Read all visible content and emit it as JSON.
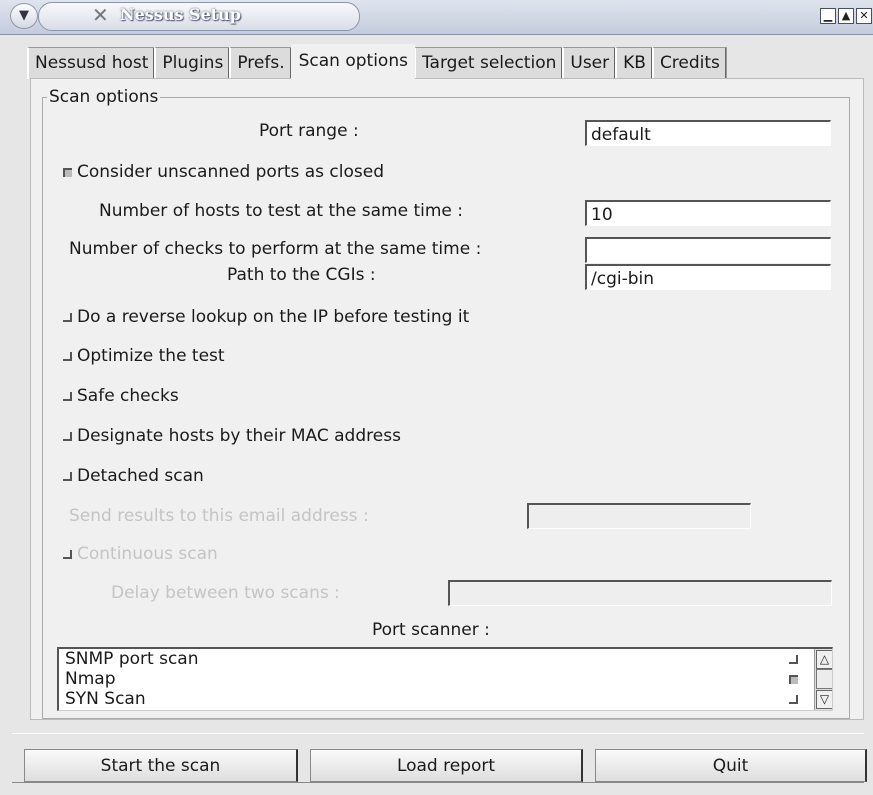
{
  "window": {
    "title": "Nessus Setup",
    "menu_icon": "menu-chevron-icon",
    "close_x_icon": "close-x-icon",
    "buttons": [
      "minimize-icon",
      "maximize-icon",
      "close-icon"
    ]
  },
  "tabs": [
    {
      "label": "Nessusd host",
      "active": false
    },
    {
      "label": "Plugins",
      "active": false
    },
    {
      "label": "Prefs.",
      "active": false
    },
    {
      "label": "Scan options",
      "active": true
    },
    {
      "label": "Target selection",
      "active": false
    },
    {
      "label": "User",
      "active": false
    },
    {
      "label": "KB",
      "active": false
    },
    {
      "label": "Credits",
      "active": false
    }
  ],
  "scan_options": {
    "legend": "Scan options",
    "port_range": {
      "label": "Port range :",
      "value": "default"
    },
    "consider_unscanned": {
      "label": "Consider unscanned ports as closed",
      "checked": true
    },
    "hosts_same_time": {
      "label": "Number of hosts to test at the same time :",
      "value": "10"
    },
    "checks_same_time": {
      "label": "Number of checks to perform at the same time :",
      "value": ""
    },
    "cgi_path": {
      "label": "Path to the CGIs :",
      "value": "/cgi-bin"
    },
    "reverse_lookup": {
      "label": "Do a reverse lookup on the IP before testing it",
      "checked": false
    },
    "optimize": {
      "label": "Optimize the test",
      "checked": false
    },
    "safe_checks": {
      "label": "Safe checks",
      "checked": false
    },
    "mac_address": {
      "label": "Designate hosts by their MAC address",
      "checked": false
    },
    "detached": {
      "label": "Detached scan",
      "checked": false
    },
    "email": {
      "label": "Send results to this email address :",
      "value": ""
    },
    "continuous": {
      "label": "Continuous scan",
      "checked": false
    },
    "delay": {
      "label": "Delay between two scans :",
      "value": ""
    },
    "port_scanner": {
      "label": "Port scanner :",
      "items": [
        {
          "name": "SNMP port scan",
          "checked": false
        },
        {
          "name": "Nmap",
          "checked": true
        },
        {
          "name": "SYN Scan",
          "checked": false
        }
      ]
    }
  },
  "footer": {
    "start": "Start the scan",
    "load": "Load report",
    "quit": "Quit"
  }
}
